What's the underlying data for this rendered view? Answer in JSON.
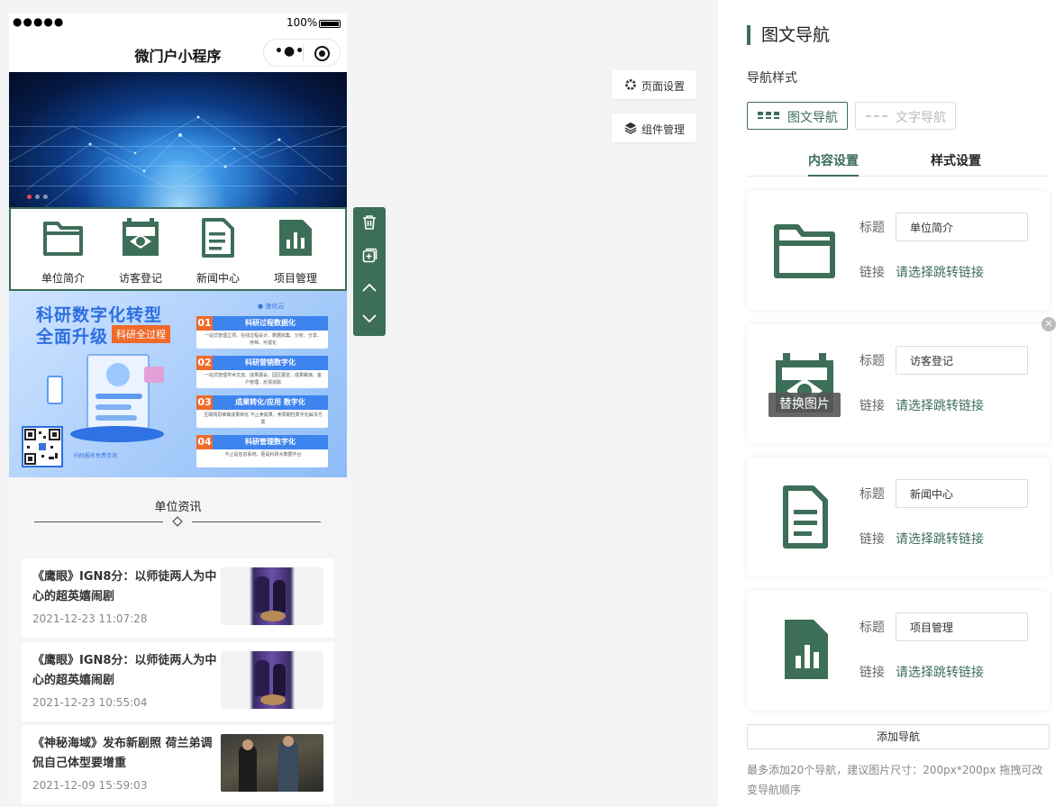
{
  "phone": {
    "status": {
      "signal": "●●●●●",
      "battery": "100%"
    },
    "title": "微门户小程序",
    "capsule": {
      "more": "•●•"
    },
    "image_nav": [
      {
        "label": "单位简介",
        "icon": "folder-icon"
      },
      {
        "label": "访客登记",
        "icon": "visitor-icon"
      },
      {
        "label": "新闻中心",
        "icon": "document-icon"
      },
      {
        "label": "项目管理",
        "icon": "bar-chart-icon"
      }
    ],
    "ad": {
      "headline1": "科研数字化转型",
      "headline2": "全面升级",
      "tag": "科研全过程",
      "brand": "● 速优云",
      "rows": [
        {
          "num": "01",
          "head": "科研过程数据化",
          "desc": "一站式管理立项、在线过程设计、数据收集、分析、分享、存档、可视化"
        },
        {
          "num": "02",
          "head": "科研营销数字化",
          "desc": "一站式管理学术交流、成果展会、园区展览、成果路演、客户管理、反馈追踪"
        },
        {
          "num": "03",
          "head": "成果转化/应用 数字化",
          "desc": "互联网思维做成果转化 不止卖成果，卖周期性数字化解决方案"
        },
        {
          "num": "04",
          "head": "科研管理数字化",
          "desc": "不止是信息系统，更是科研大数据平台"
        }
      ],
      "qr_note": "扫码报名免费咨询"
    },
    "section_title": "单位资讯",
    "news": [
      {
        "title": "《鹰眼》IGN8分：以师徒两人为中心的超英嬉闹剧",
        "date": "2021-12-23 11:07:28"
      },
      {
        "title": "《鹰眼》IGN8分：以师徒两人为中心的超英嬉闹剧",
        "date": "2021-12-23 10:55:04"
      },
      {
        "title": "《神秘海域》发布新剧照 荷兰弟调侃自己体型要增重",
        "date": "2021-12-09 15:59:03"
      }
    ]
  },
  "floating": {
    "page_settings": "页面设置",
    "component_manage": "组件管理"
  },
  "panel": {
    "title": "图文导航",
    "style_label": "导航样式",
    "style_options": [
      {
        "label": "图文导航",
        "active": true
      },
      {
        "label": "文字导航",
        "active": false
      }
    ],
    "tabs": [
      {
        "label": "内容设置",
        "active": true
      },
      {
        "label": "样式设置",
        "active": false
      }
    ],
    "field_title_label": "标题",
    "field_link_label": "链接",
    "link_placeholder": "请选择跳转链接",
    "replace_image": "替换图片",
    "items": [
      {
        "title": "单位简介",
        "icon": "folder-icon"
      },
      {
        "title": "访客登记",
        "icon": "visitor-icon"
      },
      {
        "title": "新闻中心",
        "icon": "document-icon"
      },
      {
        "title": "项目管理",
        "icon": "bar-chart-icon"
      }
    ],
    "add_button": "添加导航",
    "tip": "最多添加20个导航，建议图片尺寸：200px*200px 拖拽可改变导航顺序"
  },
  "colors": {
    "accent": "#3d6e58",
    "ad_blue": "#2c6fe0",
    "ad_orange": "#f06a2b"
  }
}
